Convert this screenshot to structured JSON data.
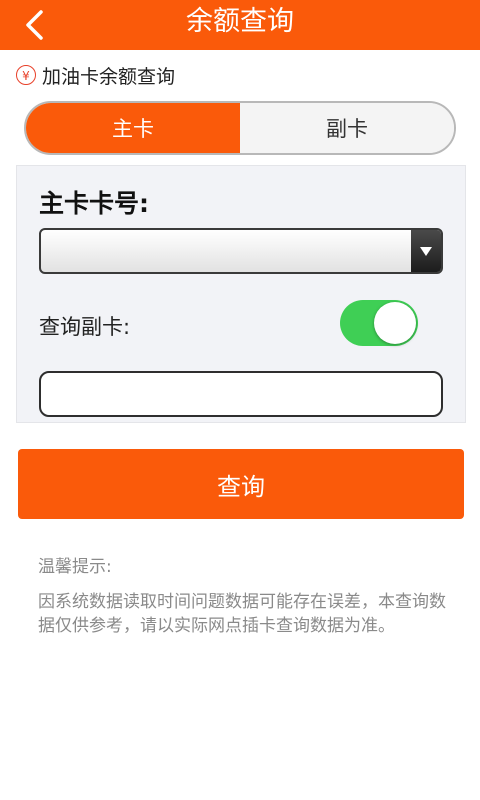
{
  "header": {
    "title": "余额查询",
    "back_icon": "chevron-left-icon"
  },
  "section": {
    "icon": "yen-icon",
    "icon_glyph": "¥",
    "title": "加油卡余额查询"
  },
  "tabs": [
    {
      "label": "主卡",
      "active": true
    },
    {
      "label": "副卡",
      "active": false
    }
  ],
  "form": {
    "card_label": "主卡卡号:",
    "card_select_value": "",
    "sub_card_toggle_label": "查询副卡:",
    "sub_card_toggle_on": true,
    "sub_card_input_value": "",
    "sub_card_input_placeholder": ""
  },
  "actions": {
    "query_label": "查询"
  },
  "tips": {
    "title": "温馨提示:",
    "body": "因系统数据读取时间问题数据可能存在误差，本查询数据仅供参考，请以实际网点插卡查询数据为准。"
  },
  "colors": {
    "accent": "#fa5a0a",
    "toggle_on": "#3fcf55",
    "icon_red": "#e8412a",
    "tip_text": "#8a8a8a"
  }
}
